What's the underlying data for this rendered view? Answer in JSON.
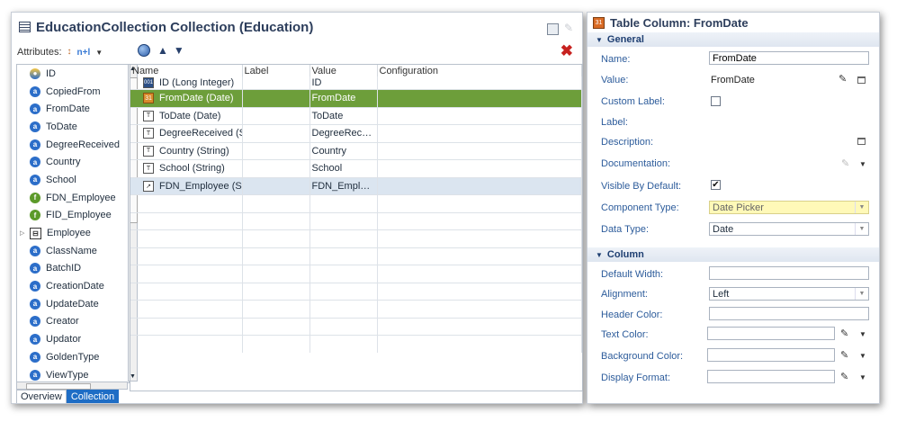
{
  "left": {
    "title": "EducationCollection Collection (Education)",
    "attributes_label": "Attributes:",
    "nplus_label": "n+l",
    "attributes": [
      {
        "label": "ID",
        "icon": "key"
      },
      {
        "label": "CopiedFrom",
        "icon": "attribute"
      },
      {
        "label": "FromDate",
        "icon": "attribute"
      },
      {
        "label": "ToDate",
        "icon": "attribute"
      },
      {
        "label": "DegreeReceived",
        "icon": "attribute"
      },
      {
        "label": "Country",
        "icon": "attribute"
      },
      {
        "label": "School",
        "icon": "attribute"
      },
      {
        "label": "FDN_Employee",
        "icon": "foreign-key"
      },
      {
        "label": "FID_Employee",
        "icon": "foreign-key"
      },
      {
        "label": "Employee",
        "icon": "relation"
      },
      {
        "label": "ClassName",
        "icon": "attribute"
      },
      {
        "label": "BatchID",
        "icon": "attribute"
      },
      {
        "label": "CreationDate",
        "icon": "attribute"
      },
      {
        "label": "UpdateDate",
        "icon": "attribute"
      },
      {
        "label": "Creator",
        "icon": "attribute"
      },
      {
        "label": "Updator",
        "icon": "attribute"
      },
      {
        "label": "GoldenType",
        "icon": "attribute"
      },
      {
        "label": "ViewType",
        "icon": "attribute"
      }
    ],
    "grid": {
      "headers": {
        "name": "Name",
        "label": "Label",
        "value": "Value",
        "config": "Configuration"
      },
      "rows": [
        {
          "name": "ID (Long Integer)",
          "label": "",
          "value": "ID",
          "config": "",
          "icon": "number"
        },
        {
          "name": "FromDate (Date)",
          "label": "",
          "value": "FromDate",
          "config": "",
          "icon": "calendar"
        },
        {
          "name": "ToDate (Date)",
          "label": "",
          "value": "ToDate",
          "config": "",
          "icon": "text"
        },
        {
          "name": "DegreeReceived (S...",
          "label": "",
          "value": "DegreeReceiv...",
          "config": "",
          "icon": "text"
        },
        {
          "name": "Country (String)",
          "label": "",
          "value": "Country",
          "config": "",
          "icon": "text"
        },
        {
          "name": "School (String)",
          "label": "",
          "value": "School",
          "config": "",
          "icon": "text"
        },
        {
          "name": "FDN_Employee (St...",
          "label": "",
          "value": "FDN_Employee",
          "config": "",
          "icon": "link"
        }
      ]
    },
    "tabs": [
      "Overview",
      "Collection"
    ]
  },
  "right": {
    "title": "Table Column: FromDate",
    "general_label": "General",
    "column_label": "Column",
    "name_label": "Name:",
    "name_value": "FromDate",
    "value_label": "Value:",
    "value_value": "FromDate",
    "custom_label_label": "Custom Label:",
    "label_label": "Label:",
    "description_label": "Description:",
    "documentation_label": "Documentation:",
    "visible_label": "Visible By Default:",
    "component_type_label": "Component Type:",
    "component_type_value": "Date Picker",
    "data_type_label": "Data Type:",
    "data_type_value": "Date",
    "default_width_label": "Default Width:",
    "alignment_label": "Alignment:",
    "alignment_value": "Left",
    "header_color_label": "Header Color:",
    "text_color_label": "Text Color:",
    "background_color_label": "Background Color:",
    "display_format_label": "Display Format:"
  },
  "colors": {
    "selected_row": "#6d9e3a",
    "alt_row": "#dbe5f0",
    "highlight_field": "#fff9b8",
    "active_tab": "#1e6dc5"
  }
}
